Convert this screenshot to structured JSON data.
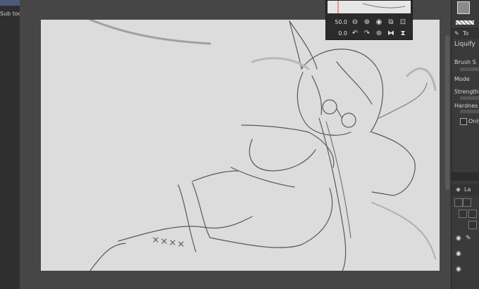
{
  "left_panel": {
    "subtool_label": "Sub tool"
  },
  "navigator": {
    "zoom_value": "50.0",
    "rotation_value": "0.0",
    "zoom_icons": [
      "zoom-out-icon",
      "zoom-in-icon",
      "fit-icon",
      "actual-size-icon",
      "fit-window-icon"
    ],
    "rotate_icons": [
      "rotate-left-icon",
      "rotate-right-icon",
      "reset-rotation-icon",
      "flip-horizontal-icon",
      "flip-vertical-icon"
    ]
  },
  "tool_property": {
    "tool_name": "Liquify",
    "header_label": "To",
    "brush_size_label": "Brush S",
    "mode_label": "Mode",
    "strength_label": "Strength",
    "hardness_label": "Hardnes",
    "only_label": "Only"
  },
  "layer_panel": {
    "header_label": "La"
  },
  "colors": {
    "main": "#8a8a8a",
    "sub": "#000000",
    "canvas": "#dcdcdc"
  }
}
